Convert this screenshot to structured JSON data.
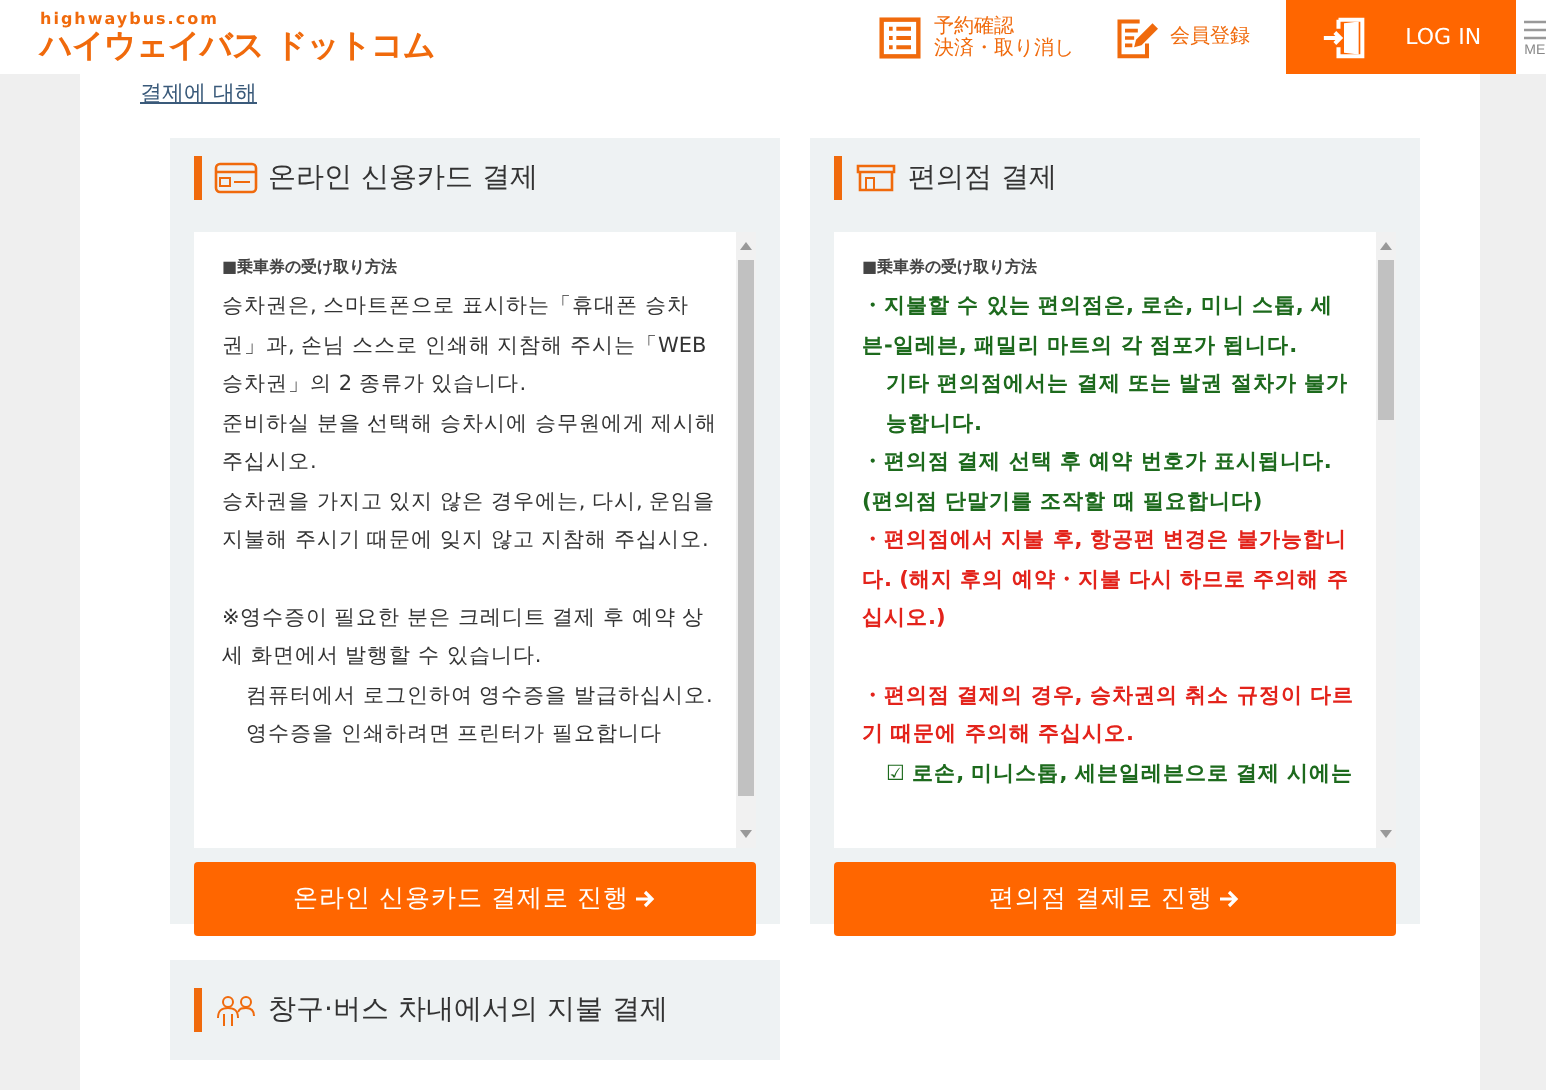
{
  "header": {
    "logo_domain": "highwaybus.com",
    "logo": "ハイウェイバス ドットコム",
    "nav": [
      {
        "kind": "reserve",
        "lines": [
          "予約確認",
          "決済・取り消し"
        ]
      },
      {
        "kind": "member",
        "lines": [
          "会員登録"
        ]
      },
      {
        "kind": "login",
        "lines": [
          "LOG IN"
        ]
      }
    ],
    "menu_label": "ME"
  },
  "about_link": "결제에 대해",
  "cards": [
    {
      "kind": "card",
      "title": "온라인 신용카드 결제",
      "box_heading": "■乗車券の受け取り方法",
      "paragraphs": [
        {
          "kind": "plain",
          "indent": false,
          "text": "승차권은, 스마트폰으로 표시하는「휴대폰 승차권」과, 손님 스스로 인쇄해 지참해 주시는「WEB 승차권」의 2 종류가 있습니다."
        },
        {
          "kind": "plain",
          "indent": false,
          "text": "준비하실 분을 선택해 승차시에 승무원에게 제시해 주십시오."
        },
        {
          "kind": "plain",
          "indent": false,
          "text": "승차권을 가지고 있지 않은 경우에는, 다시, 운임을 지불해 주시기 때문에 잊지 않고 지참해 주십시오."
        },
        {
          "kind": "blank"
        },
        {
          "kind": "plain",
          "indent": false,
          "text": "※영수증이 필요한 분은 크레디트 결제 후 예약 상세 화면에서 발행할 수 있습니다."
        },
        {
          "kind": "plain",
          "indent": true,
          "text": "컴퓨터에서 로그인하여 영수증을 발급하십시오."
        },
        {
          "kind": "plain",
          "indent": true,
          "text": "영수증을 인쇄하려면 프린터가 필요합니다"
        }
      ],
      "button": "온라인 신용카드 결제로 진행"
    },
    {
      "kind": "store",
      "title": "편의점 결제",
      "box_heading": "■乗車券の受け取り方法",
      "paragraphs": [
        {
          "kind": "green",
          "indent": false,
          "text": "・지불할 수 있는 편의점은, 로손, 미니 스톱, 세븐-일레븐, 패밀리 마트의 각 점포가 됩니다."
        },
        {
          "kind": "green",
          "indent": true,
          "text": "기타 편의점에서는 결제 또는 발권 절차가 불가능합니다."
        },
        {
          "kind": "green",
          "indent": false,
          "text": "・편의점 결제 선택 후 예약 번호가 표시됩니다. (편의점 단말기를 조작할 때 필요합니다)"
        },
        {
          "kind": "red",
          "indent": false,
          "text": "・편의점에서 지불 후, 항공편 변경은 불가능합니다. (해지 후의 예약・지불 다시 하므로 주의해 주십시오.)"
        },
        {
          "kind": "blank"
        },
        {
          "kind": "red",
          "indent": false,
          "text": "・편의점 결제의 경우, 승차권의 취소 규정이 다르기 때문에 주의해 주십시오."
        },
        {
          "kind": "green",
          "indent": true,
          "text": "☑ 로손, 미니스톱, 세븐일레븐으로 결제 시에는"
        }
      ],
      "button": "편의점 결제로 진행"
    }
  ],
  "bottom_card": {
    "title": "창구·버스 차내에서의 지불 결제"
  }
}
